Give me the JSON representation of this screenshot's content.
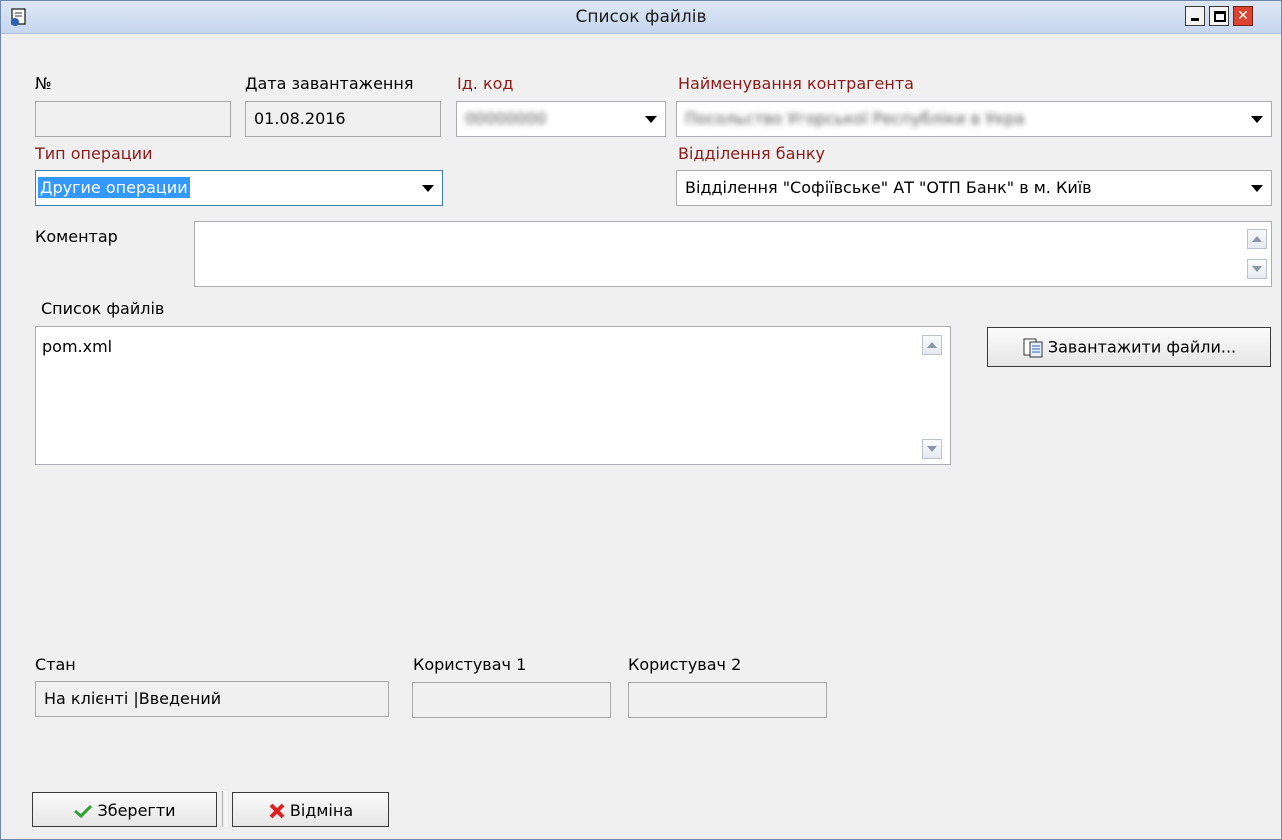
{
  "window": {
    "title": "Список файлів"
  },
  "labels": {
    "number": "№",
    "upload_date": "Дата завантаження",
    "id_code": "Ід. код",
    "counterparty_name": "Найменування контрагента",
    "operation_type": "Тип операции",
    "bank_branch": "Відділення банку",
    "comment": "Коментар",
    "file_list": "Список файлів",
    "status": "Стан",
    "user1": "Користувач 1",
    "user2": "Користувач 2"
  },
  "fields": {
    "number": "",
    "upload_date": "01.08.2016",
    "id_code": "00000000",
    "counterparty_name": "Посольство Угорської Республіки в Укра",
    "operation_type": "Другие операции",
    "bank_branch": "Відділення \"Софіївське\" АТ \"ОТП Банк\" в м. Київ",
    "comment": "",
    "status": "На клієнті |Введений",
    "user1": "",
    "user2": ""
  },
  "files": [
    "pom.xml"
  ],
  "buttons": {
    "upload_files": "Завантажити файли...",
    "save": "Зберегти",
    "cancel": "Відміна"
  },
  "icons": {
    "app": "document-app-icon",
    "upload": "document-folder-icon",
    "save": "checkmark-icon",
    "cancel": "red-x-icon"
  },
  "colors": {
    "required_label": "#8b1a1a",
    "selection": "#3399ff",
    "save_check": "#2e9e2e",
    "cancel_x": "#e02020"
  }
}
